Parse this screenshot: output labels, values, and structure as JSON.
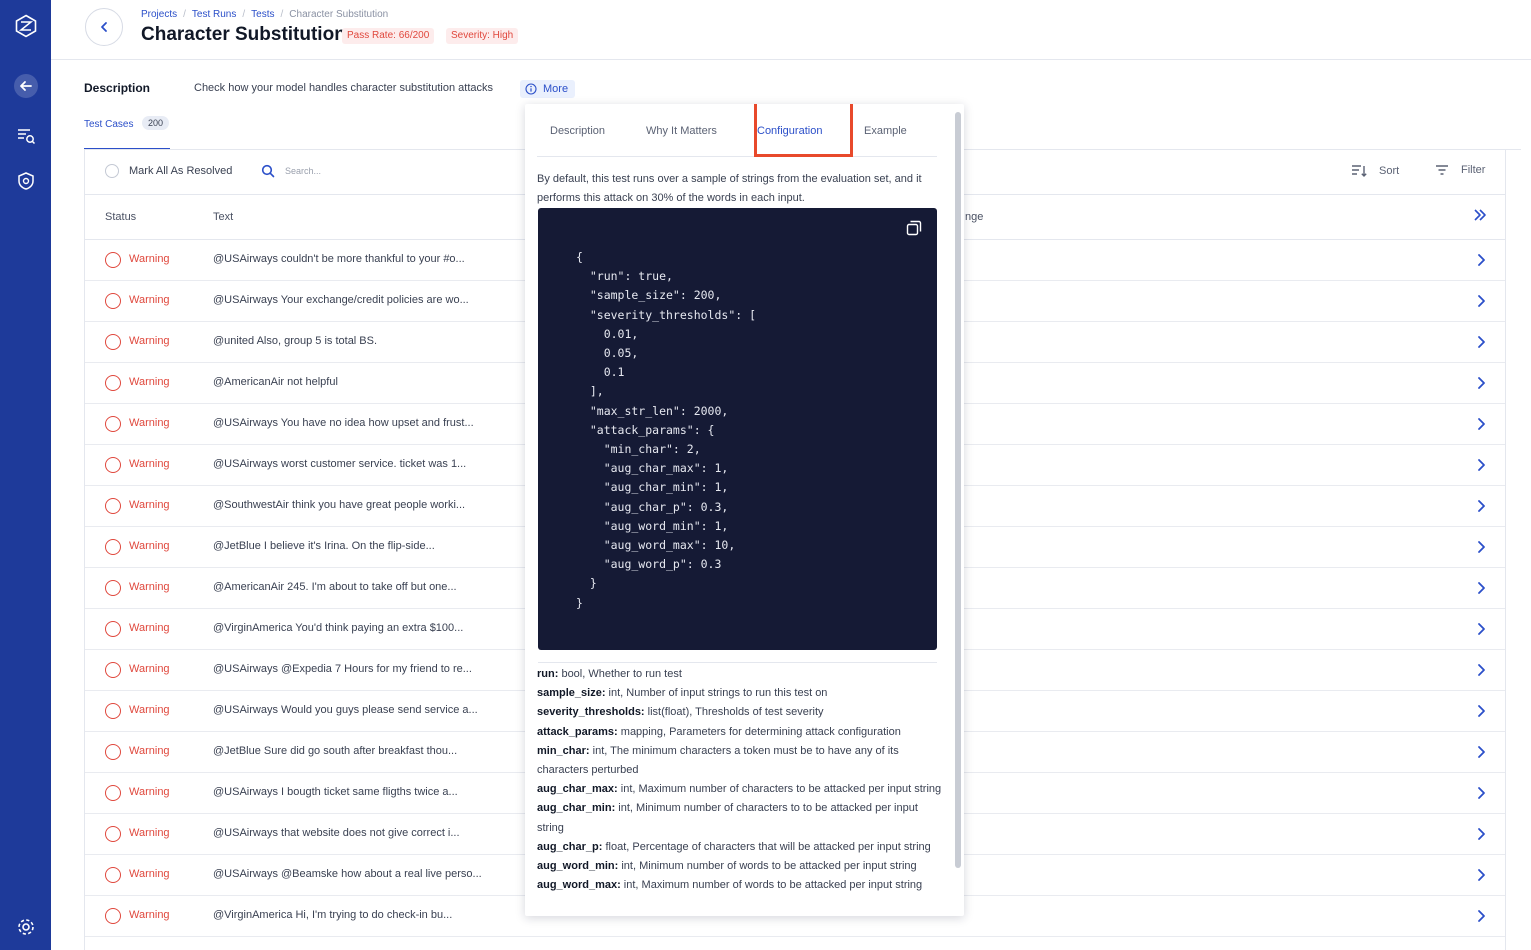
{
  "sidebar": {
    "icons": [
      "logo-icon",
      "back-arrow-icon",
      "search-document-icon",
      "shield-icon",
      "settings-icon"
    ]
  },
  "header": {
    "breadcrumb": [
      "Projects",
      "Test Runs",
      "Tests",
      "Character Substitution"
    ],
    "title": "Character Substitution",
    "badges": {
      "pass_rate": "Pass Rate: 66/200",
      "severity": "Severity: High"
    }
  },
  "description": {
    "label": "Description",
    "text": "Check how your model handles character substitution attacks",
    "more_label": "More"
  },
  "tabs": {
    "test_cases_label": "Test Cases",
    "test_cases_count": "200"
  },
  "toolbar": {
    "mark_all_label": "Mark All As Resolved",
    "search_placeholder": "Search...",
    "sort_label": "Sort",
    "filter_label": "Filter"
  },
  "table": {
    "columns": {
      "status": "Status",
      "text": "Text",
      "change": "nge"
    },
    "rows": [
      {
        "status": "Warning",
        "text": "@USAirways couldn't be more thankful to your #o..."
      },
      {
        "status": "Warning",
        "text": "@USAirways Your exchange/credit policies are wo..."
      },
      {
        "status": "Warning",
        "text": "@united Also, group 5 is total BS."
      },
      {
        "status": "Warning",
        "text": "@AmericanAir not helpful"
      },
      {
        "status": "Warning",
        "text": "@USAirways You have no idea how upset and frust..."
      },
      {
        "status": "Warning",
        "text": "@USAirways worst customer service. ticket was 1..."
      },
      {
        "status": "Warning",
        "text": "@SouthwestAir think you have great people worki..."
      },
      {
        "status": "Warning",
        "text": "@JetBlue I believe it's Irina. On the flip-side..."
      },
      {
        "status": "Warning",
        "text": "@AmericanAir 245. I'm about to take off but one..."
      },
      {
        "status": "Warning",
        "text": "@VirginAmerica You'd think paying an extra $100..."
      },
      {
        "status": "Warning",
        "text": "@USAirways @Expedia 7 Hours for my friend to re..."
      },
      {
        "status": "Warning",
        "text": "@USAirways Would you guys please send service a..."
      },
      {
        "status": "Warning",
        "text": "@JetBlue Sure did go south after breakfast thou..."
      },
      {
        "status": "Warning",
        "text": "@USAirways I bougth ticket same fligths twice a..."
      },
      {
        "status": "Warning",
        "text": "@USAirways that website does not give correct i..."
      },
      {
        "status": "Warning",
        "text": "@USAirways @Beamske how about a real live perso..."
      },
      {
        "status": "Warning",
        "text": "@VirginAmerica Hi, I'm trying to do check-in bu..."
      }
    ]
  },
  "popover": {
    "tabs": [
      "Description",
      "Why It Matters",
      "Configuration",
      "Example"
    ],
    "active_tab": "Configuration",
    "intro": "By default, this test runs over a sample of strings from the evaluation set, and it performs this attack on 30% of the words in each input.",
    "code": "{\n  \"run\": true,\n  \"sample_size\": 200,\n  \"severity_thresholds\": [\n    0.01,\n    0.05,\n    0.1\n  ],\n  \"max_str_len\": 2000,\n  \"attack_params\": {\n    \"min_char\": 2,\n    \"aug_char_max\": 1,\n    \"aug_char_min\": 1,\n    \"aug_char_p\": 0.3,\n    \"aug_word_min\": 1,\n    \"aug_word_max\": 10,\n    \"aug_word_p\": 0.3\n  }\n}",
    "params": [
      {
        "name": "run:",
        "desc": " bool, Whether to run test"
      },
      {
        "name": "sample_size:",
        "desc": " int, Number of input strings to run this test on"
      },
      {
        "name": "severity_thresholds:",
        "desc": " list(float), Thresholds of test severity"
      },
      {
        "name": "attack_params:",
        "desc": " mapping, Parameters for determining attack configuration"
      },
      {
        "name": "min_char:",
        "desc": " int, The minimum characters a token must be to have any of its characters perturbed"
      },
      {
        "name": "aug_char_max:",
        "desc": " int, Maximum number of characters to be attacked per input string"
      },
      {
        "name": "aug_char_min:",
        "desc": " int, Minimum number of characters to to be attacked per input string"
      },
      {
        "name": "aug_char_p:",
        "desc": " float, Percentage of characters that will be attacked per input string"
      },
      {
        "name": "aug_word_min:",
        "desc": " int, Minimum number of words to be attacked per input string"
      },
      {
        "name": "aug_word_max:",
        "desc": " int, Maximum number of words to be attacked per input string"
      }
    ]
  },
  "colors": {
    "sidebar": "#1e3a9a",
    "accent": "#2b4fc9",
    "warning": "#e0483d",
    "code_bg": "#151a35",
    "highlight": "#e8492b"
  }
}
